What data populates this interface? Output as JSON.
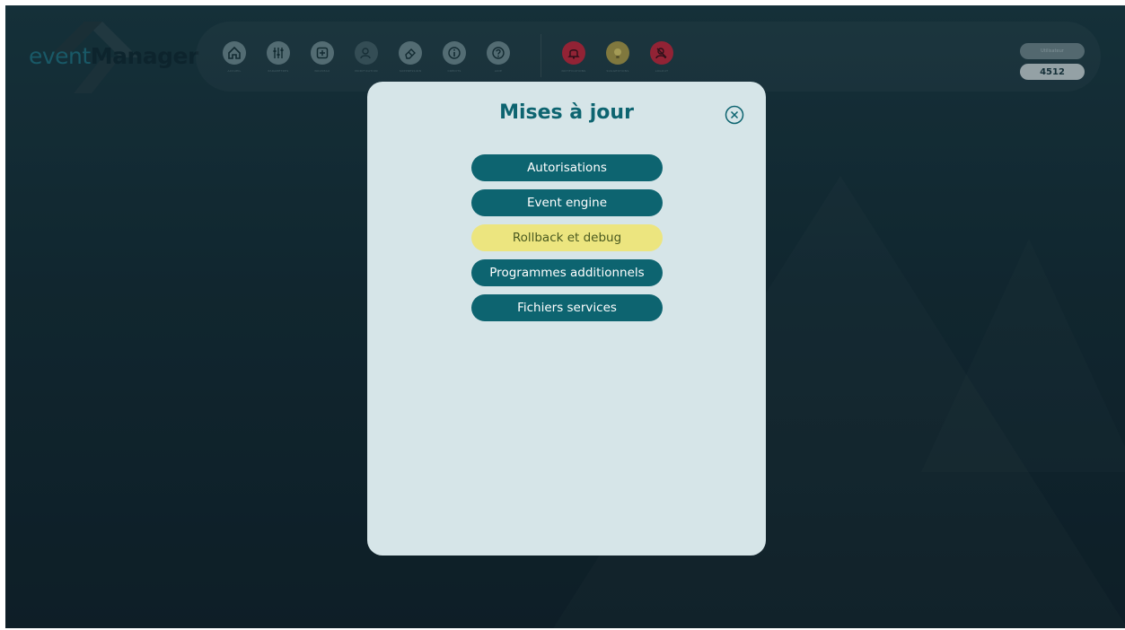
{
  "app": {
    "logo_event": "event",
    "logo_manager": "Manager"
  },
  "toolbar": {
    "tools": [
      {
        "name": "accueil",
        "label": "ACCUEIL",
        "icon": "home-icon",
        "color": "#6d8a91",
        "dim": false
      },
      {
        "name": "parametres",
        "label": "PARAMÈTRES",
        "icon": "sliders-icon",
        "color": "#6d8a91",
        "dim": false
      },
      {
        "name": "nouveau",
        "label": "NOUVEAU",
        "icon": "plus-box-icon",
        "color": "#6d8a91",
        "dim": false
      },
      {
        "name": "modification",
        "label": "MODIFICATION",
        "icon": "user-edit-icon",
        "color": "#6d8a91",
        "dim": true
      },
      {
        "name": "suppression",
        "label": "SUPPRESSION",
        "icon": "eraser-icon",
        "color": "#6d8a91",
        "dim": false
      },
      {
        "name": "credits",
        "label": "CRÉDITS",
        "icon": "info-icon",
        "color": "#6d8a91",
        "dim": false
      },
      {
        "name": "aide",
        "label": "AIDE",
        "icon": "question-icon",
        "color": "#6d8a91",
        "dim": false
      },
      {
        "name": "notifications",
        "label": "NOTIFICATIONS",
        "icon": "bell-icon",
        "color": "#c0283e",
        "dim": false
      },
      {
        "name": "suggestions",
        "label": "SUGGESTIONS",
        "icon": "lightbulb-icon",
        "color": "#a89a4a",
        "dim": false
      },
      {
        "name": "logout",
        "label": "LOGOUT",
        "icon": "user-logout-icon",
        "color": "#c0283e",
        "dim": false
      }
    ],
    "user_label": "Utilisateur",
    "code": "4512"
  },
  "modal": {
    "title": "Mises à jour",
    "close_icon": "close-circle-icon",
    "buttons": [
      {
        "label": "Autorisations",
        "state": "normal"
      },
      {
        "label": "Event engine",
        "state": "normal"
      },
      {
        "label": "Rollback et debug",
        "state": "active"
      },
      {
        "label": "Programmes additionnels",
        "state": "normal"
      },
      {
        "label": "Fichiers services",
        "state": "normal"
      }
    ]
  },
  "colors": {
    "accent": "#0d6470",
    "highlight": "#ece57f",
    "modal_bg": "#d6e5e8",
    "background": "#142d36"
  }
}
